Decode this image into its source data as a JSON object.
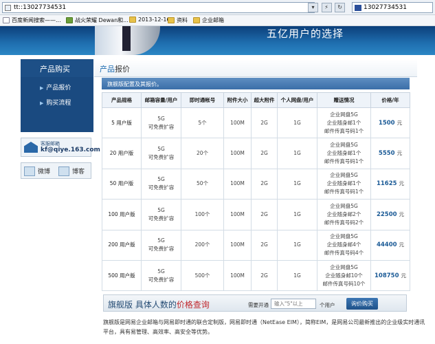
{
  "browser": {
    "address": "tt::13027734531",
    "search": "13027734531",
    "favorites": [
      "百度新闻搜索——...",
      "战火荣耀 Dewan和...",
      "2013-12-16",
      "资料",
      "企业邮箱"
    ]
  },
  "banner": {
    "slogan": "五亿用户的选择"
  },
  "sidebar": {
    "title": "产品购买",
    "items": [
      {
        "label": "产品报价"
      },
      {
        "label": "购买流程"
      }
    ],
    "mail": {
      "label": "客服邮箱",
      "address": "kf@qiye.163.com"
    },
    "social": [
      {
        "label": "微博"
      },
      {
        "label": "博客"
      }
    ]
  },
  "main": {
    "title_a": "产品",
    "title_b": "报价",
    "config_bar": "旗舰版配置及其报价。",
    "columns": [
      "产品规格",
      "邮箱容量/用户",
      "即时通帐号",
      "附件大小",
      "超大附件",
      "个人网盘/用户",
      "赠送情况",
      "价格/年"
    ],
    "rows": [
      {
        "spec_num": "5",
        "spec_unit": "用户版",
        "cap1": "5G",
        "cap2": "可免费扩容",
        "im": "5个",
        "attach": "100M",
        "big": "2G",
        "disk": "1G",
        "gift1": "企业网盘5G",
        "gift2": "企业随身邮1个",
        "gift3": "邮件传真号码1个",
        "price": "1500",
        "unit": "元"
      },
      {
        "spec_num": "20",
        "spec_unit": "用户版",
        "cap1": "5G",
        "cap2": "可免费扩容",
        "im": "20个",
        "attach": "100M",
        "big": "2G",
        "disk": "1G",
        "gift1": "企业网盘5G",
        "gift2": "企业随身邮1个",
        "gift3": "邮件传真号码1个",
        "price": "5550",
        "unit": "元"
      },
      {
        "spec_num": "50",
        "spec_unit": "用户版",
        "cap1": "5G",
        "cap2": "可免费扩容",
        "im": "50个",
        "attach": "100M",
        "big": "2G",
        "disk": "1G",
        "gift1": "企业网盘5G",
        "gift2": "企业随身邮1个",
        "gift3": "邮件传真号码1个",
        "price": "11625",
        "unit": "元"
      },
      {
        "spec_num": "100",
        "spec_unit": "用户版",
        "cap1": "5G",
        "cap2": "可免费扩容",
        "im": "100个",
        "attach": "100M",
        "big": "2G",
        "disk": "1G",
        "gift1": "企业网盘5G",
        "gift2": "企业随身邮2个",
        "gift3": "邮件传真号码2个",
        "price": "22500",
        "unit": "元"
      },
      {
        "spec_num": "200",
        "spec_unit": "用户版",
        "cap1": "5G",
        "cap2": "可免费扩容",
        "im": "200个",
        "attach": "100M",
        "big": "2G",
        "disk": "1G",
        "gift1": "企业网盘5G",
        "gift2": "企业随身邮4个",
        "gift3": "邮件传真号码4个",
        "price": "44400",
        "unit": "元"
      },
      {
        "spec_num": "500",
        "spec_unit": "用户版",
        "cap1": "5G",
        "cap2": "可免费扩容",
        "im": "500个",
        "attach": "100M",
        "big": "2G",
        "disk": "1G",
        "gift1": "企业网盘5G",
        "gift2": "企业随身邮10个",
        "gift3": "邮件传真号码10个",
        "price": "108750",
        "unit": "元"
      }
    ]
  },
  "order": {
    "title_a": "旗舰版 具体人数的",
    "title_b": "价格查询",
    "label": "需要开通",
    "placeholder": "输入\"5\"以上",
    "unit": "个用户",
    "button": "询价购买"
  },
  "description": "旗舰版是网易企业邮箱与网易即时通的联合定制版，网易即时通（NetEase EIM），简称EIM，是网易公司最新推出的企业级实时通讯平台，具有易管理、高效率、高安全等优势。",
  "colors": {
    "accent": "#1d4f86",
    "price": "#1a5a96",
    "highlight": "#c0282d"
  }
}
